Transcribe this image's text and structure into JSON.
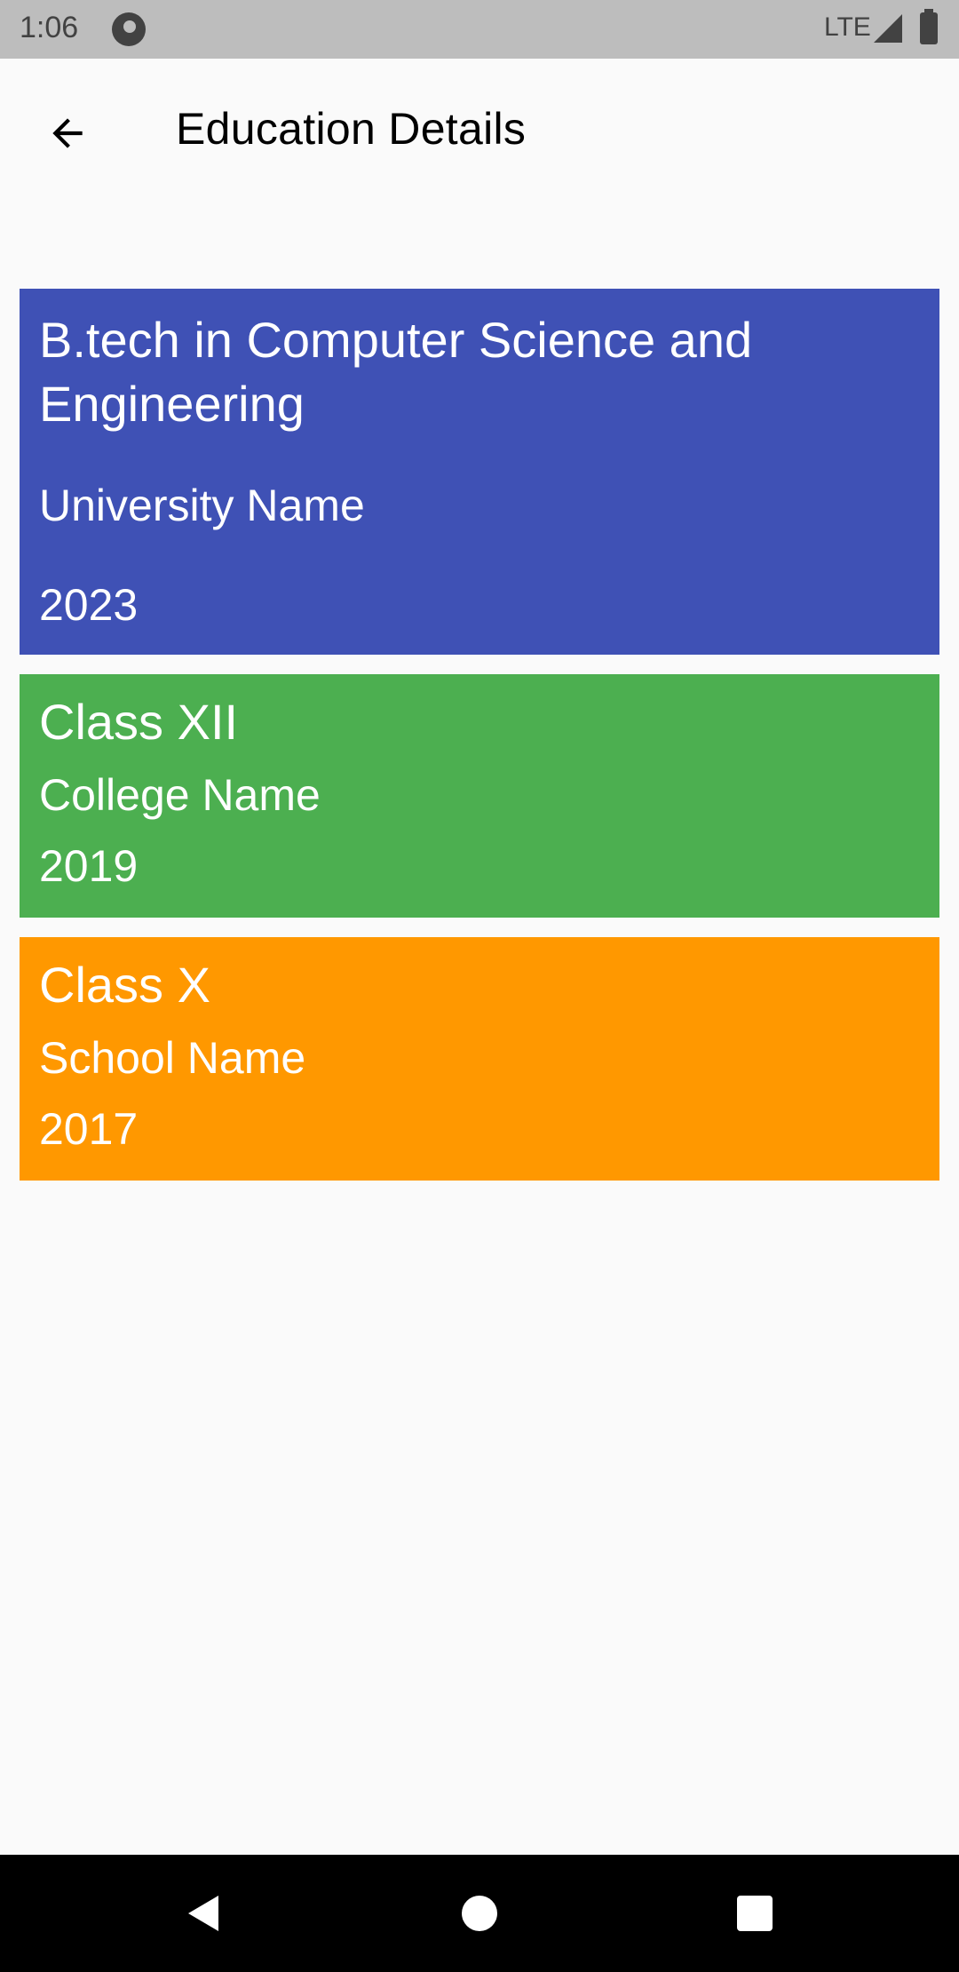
{
  "status_bar": {
    "time": "1:06",
    "network": "LTE",
    "icons": [
      "app-notification-icon",
      "signal-icon",
      "battery-icon"
    ]
  },
  "app_bar": {
    "back_icon": "arrow-back-icon",
    "title": "Education Details"
  },
  "education": [
    {
      "degree": "B.tech in Computer Science and Engineering",
      "institute": "University Name",
      "year": "2023",
      "color": "#3f51b5"
    },
    {
      "degree": "Class XII",
      "institute": "College Name",
      "year": "2019",
      "color": "#4caf50"
    },
    {
      "degree": "Class X",
      "institute": "School Name",
      "year": "2017",
      "color": "#ff9800"
    }
  ],
  "nav_bar": {
    "icons": [
      "nav-back-icon",
      "nav-home-icon",
      "nav-recents-icon"
    ]
  }
}
